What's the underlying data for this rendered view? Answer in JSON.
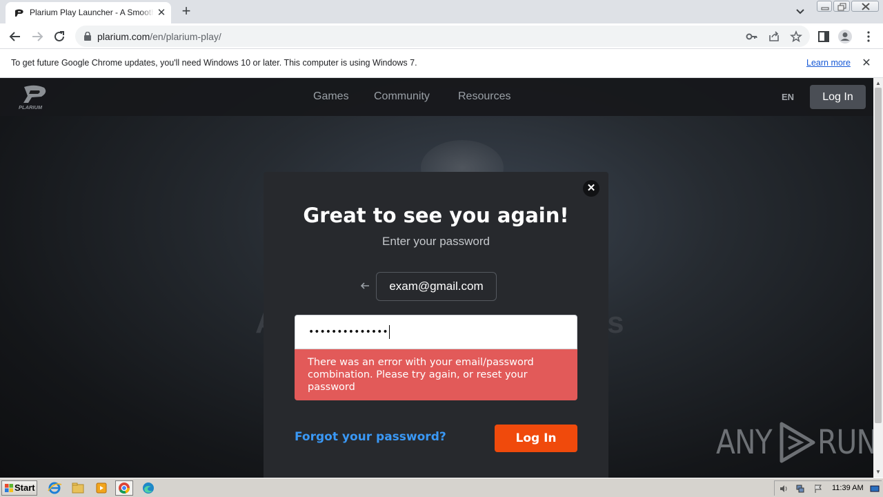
{
  "browser": {
    "tab_title": "Plarium Play Launcher - A Smoother Gaming Experience",
    "tab_close": "✕",
    "new_tab": "+",
    "url_host": "plarium.com",
    "url_path": "/en/plarium-play/"
  },
  "infobar": {
    "message": "To get future Google Chrome updates, you'll need Windows 10 or later. This computer is using Windows 7.",
    "link": "Learn more",
    "close": "✕"
  },
  "site_nav": {
    "links": [
      "Games",
      "Community",
      "Resources"
    ],
    "language": "EN",
    "login_label": "Log In",
    "logo_text": "PLARIUM"
  },
  "background": {
    "partial_left": "A",
    "partial_right": "rs"
  },
  "modal": {
    "close": "✕",
    "title": "Great to see you again!",
    "subtitle": "Enter your password",
    "email": "exam@gmail.com",
    "password_mask": "••••••••••••••",
    "error": "There was an error with your email/password combination. Please try again, or reset your password",
    "forgot_link": "Forgot your password?",
    "login_button": "Log In"
  },
  "watermark": {
    "text": "RUN",
    "prefix": "ANY"
  },
  "taskbar": {
    "start_label": "Start",
    "clock": "11:39 AM"
  },
  "colors": {
    "accent_orange": "#f04a0c",
    "error_red": "#e25a59",
    "link_blue": "#3a98f5"
  }
}
